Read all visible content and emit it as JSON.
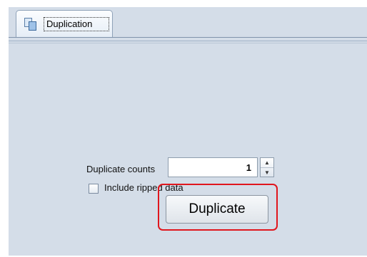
{
  "tabs": [
    {
      "label": "Duplication",
      "icon": "copy-pages-icon",
      "selected": true
    }
  ],
  "form": {
    "counts_label": "Duplicate counts",
    "counts_value": "1",
    "spinner_up": "▲",
    "spinner_down": "▼",
    "include_label": "Include ripped data",
    "include_checked": false,
    "duplicate_button": "Duplicate"
  },
  "colors": {
    "panel_background": "#d4dde8",
    "highlight": "#e0161d"
  }
}
